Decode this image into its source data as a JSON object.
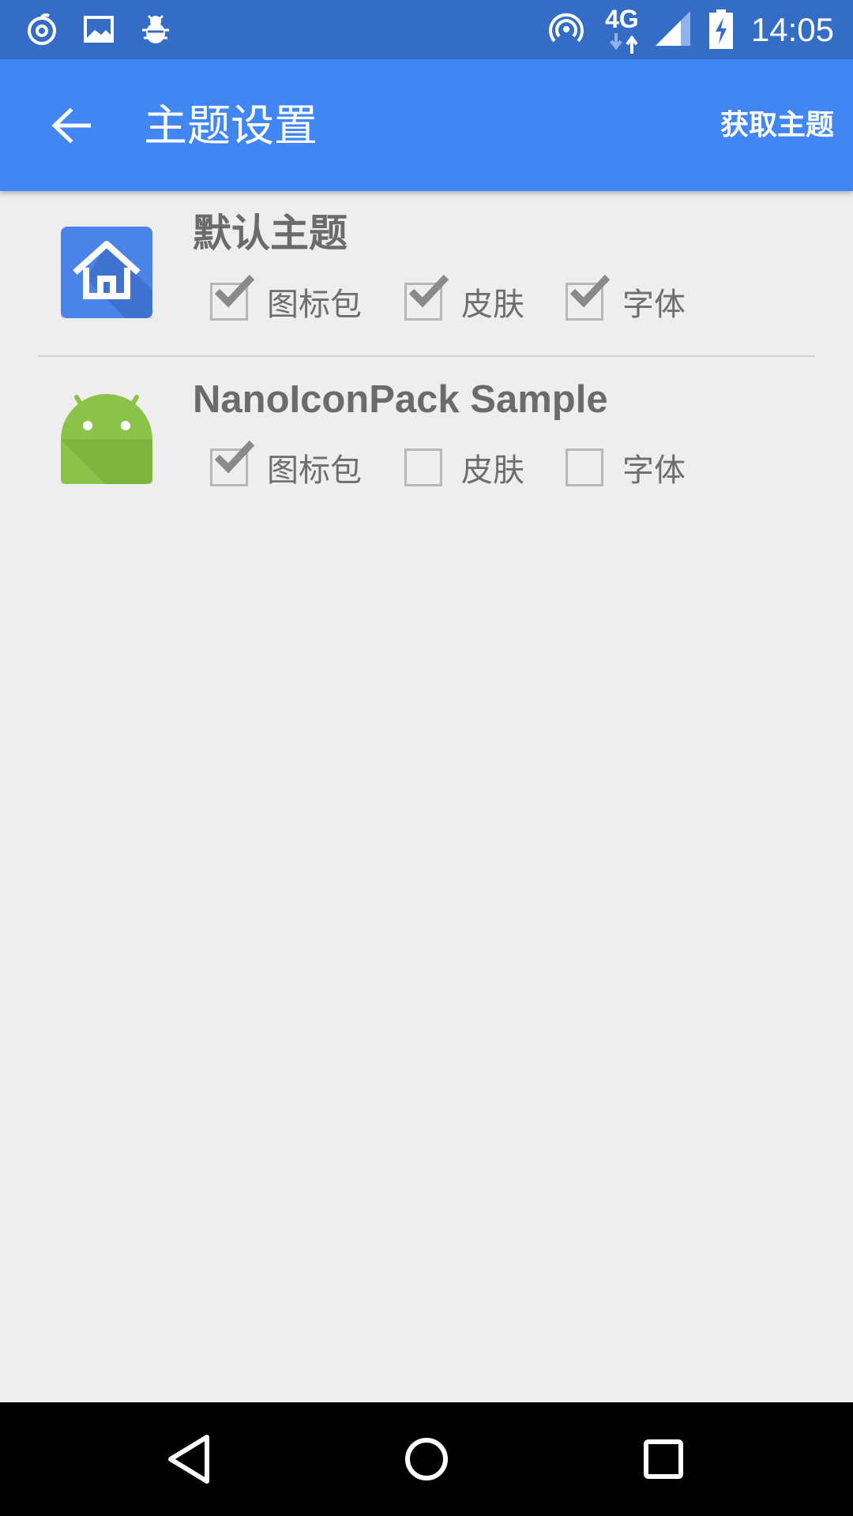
{
  "status_bar": {
    "time": "14:05",
    "network": "4G",
    "icons": [
      "music-notification-icon",
      "image-notification-icon",
      "bug-notification-icon",
      "hotspot-icon",
      "cell-signal-icon",
      "battery-charging-icon"
    ]
  },
  "app_bar": {
    "title": "主题设置",
    "action_label": "获取主题",
    "back_icon": "arrow-left-icon"
  },
  "themes": [
    {
      "name": "默认主题",
      "icon": "home-launcher-icon",
      "options": [
        {
          "label": "图标包",
          "checked": true
        },
        {
          "label": "皮肤",
          "checked": true
        },
        {
          "label": "字体",
          "checked": true
        }
      ]
    },
    {
      "name": "NanoIconPack Sample",
      "icon": "android-robot-icon",
      "options": [
        {
          "label": "图标包",
          "checked": true
        },
        {
          "label": "皮肤",
          "checked": false
        },
        {
          "label": "字体",
          "checked": false
        }
      ]
    }
  ],
  "nav_bar": {
    "buttons": [
      "back-triangle-icon",
      "home-circle-icon",
      "recents-square-icon"
    ]
  },
  "colors": {
    "status_bar": "#356DC6",
    "app_bar": "#4286F4",
    "background": "#EEEEEE",
    "check_mark": "#8A8A8A",
    "text": "#6B6B6B",
    "android_green": "#8BC34A"
  }
}
